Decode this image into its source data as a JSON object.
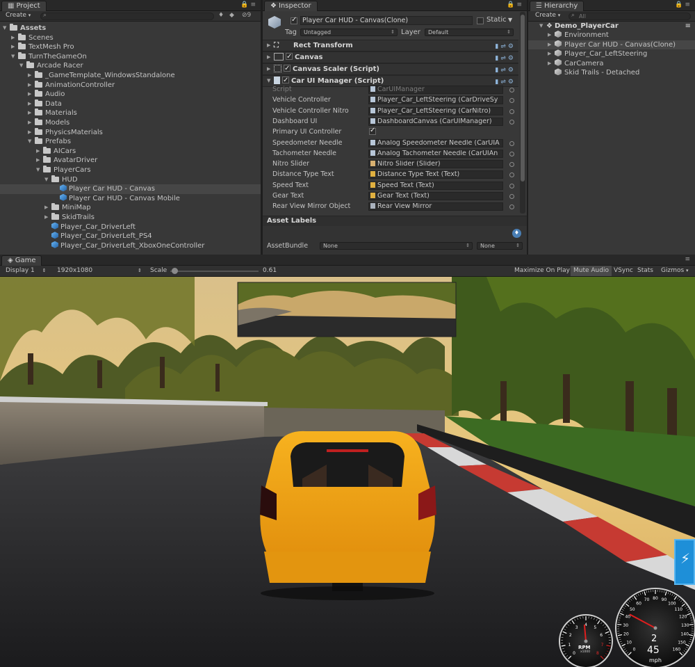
{
  "project": {
    "tab": "Project",
    "create": "Create",
    "filter_count": "9",
    "tree": [
      {
        "label": "Assets",
        "depth": 0,
        "arrow": "open",
        "bold": true
      },
      {
        "label": "Scenes",
        "depth": 1,
        "arrow": "closed"
      },
      {
        "label": "TextMesh Pro",
        "depth": 1,
        "arrow": "closed"
      },
      {
        "label": "TurnTheGameOn",
        "depth": 1,
        "arrow": "open"
      },
      {
        "label": "Arcade Racer",
        "depth": 2,
        "arrow": "open"
      },
      {
        "label": "_GameTemplate_WindowsStandalone",
        "depth": 3,
        "arrow": "closed"
      },
      {
        "label": "AnimationController",
        "depth": 3,
        "arrow": "closed"
      },
      {
        "label": "Audio",
        "depth": 3,
        "arrow": "closed"
      },
      {
        "label": "Data",
        "depth": 3,
        "arrow": "closed"
      },
      {
        "label": "Materials",
        "depth": 3,
        "arrow": "closed"
      },
      {
        "label": "Models",
        "depth": 3,
        "arrow": "closed"
      },
      {
        "label": "PhysicsMaterials",
        "depth": 3,
        "arrow": "closed"
      },
      {
        "label": "Prefabs",
        "depth": 3,
        "arrow": "open"
      },
      {
        "label": "AICars",
        "depth": 4,
        "arrow": "closed"
      },
      {
        "label": "AvatarDriver",
        "depth": 4,
        "arrow": "closed"
      },
      {
        "label": "PlayerCars",
        "depth": 4,
        "arrow": "open"
      },
      {
        "label": "HUD",
        "depth": 5,
        "arrow": "open"
      },
      {
        "label": "Player Car HUD - Canvas",
        "depth": 6,
        "prefab": true,
        "selected": true
      },
      {
        "label": "Player Car HUD - Canvas Mobile",
        "depth": 6,
        "prefab": true
      },
      {
        "label": "MiniMap",
        "depth": 5,
        "arrow": "closed"
      },
      {
        "label": "SkidTrails",
        "depth": 5,
        "arrow": "closed"
      },
      {
        "label": "Player_Car_DriverLeft",
        "depth": 5,
        "prefab": true
      },
      {
        "label": "Player_Car_DriverLeft_PS4",
        "depth": 5,
        "prefab": true
      },
      {
        "label": "Player_Car_DriverLeft_XboxOneController",
        "depth": 5,
        "prefab": true
      }
    ]
  },
  "inspector": {
    "tab": "Inspector",
    "object_name": "Player Car HUD - Canvas(Clone)",
    "static_label": "Static",
    "tag_label": "Tag",
    "tag_value": "Untagged",
    "layer_label": "Layer",
    "layer_value": "Default",
    "components": [
      {
        "label": "Rect Transform",
        "checkbox": false
      },
      {
        "label": "Canvas",
        "checkbox": true
      },
      {
        "label": "Canvas Scaler (Script)",
        "checkbox": true
      },
      {
        "label": "Car UI Manager (Script)",
        "checkbox": true
      }
    ],
    "props": [
      {
        "label": "Script",
        "value": "CarUIManager",
        "icon": "script-icon",
        "disabled": true
      },
      {
        "label": "Vehicle Controller",
        "value": "Player_Car_LeftSteering (CarDriveSy",
        "icon": "script-icon"
      },
      {
        "label": "Vehicle Controller Nitro",
        "value": "Player_Car_LeftSteering (CarNitro)",
        "icon": "script-icon"
      },
      {
        "label": "Dashboard UI",
        "value": "DashboardCanvas (CarUIManager)",
        "icon": "script-icon"
      },
      {
        "label": "Primary UI Controller",
        "value": "",
        "checkbox": true
      },
      {
        "label": "Speedometer Needle",
        "value": "Analog Speedometer Needle (CarUIA",
        "icon": "script-icon"
      },
      {
        "label": "Tachometer Needle",
        "value": "Analog Tachometer Needle (CarUIAn",
        "icon": "script-icon"
      },
      {
        "label": "Nitro Slider",
        "value": "Nitro Slider (Slider)",
        "icon": "slider-icon"
      },
      {
        "label": "Distance Type Text",
        "value": "Distance Type Text (Text)",
        "icon": "text-icon"
      },
      {
        "label": "Speed Text",
        "value": "Speed Text (Text)",
        "icon": "text-icon"
      },
      {
        "label": "Gear Text",
        "value": "Gear Text (Text)",
        "icon": "text-icon"
      },
      {
        "label": "Rear View Mirror Object",
        "value": "Rear View Mirror",
        "icon": "gameobject-icon"
      }
    ],
    "asset_labels": "Asset Labels",
    "asset_bundle_label": "AssetBundle",
    "asset_bundle_value": "None",
    "asset_bundle_variant": "None"
  },
  "hierarchy": {
    "tab": "Hierarchy",
    "create": "Create",
    "search_placeholder": "All",
    "scene": "Demo_PlayerCar",
    "items": [
      {
        "label": "Environment",
        "arrow": true
      },
      {
        "label": "Player Car HUD - Canvas(Clone)",
        "arrow": true,
        "selected": true
      },
      {
        "label": "Player_Car_LeftSteering",
        "arrow": true
      },
      {
        "label": "CarCamera",
        "arrow": true
      },
      {
        "label": "Skid Trails - Detached",
        "arrow": false
      }
    ]
  },
  "game": {
    "tab": "Game",
    "display": "Display 1",
    "resolution": "1920x1080",
    "scale_label": "Scale",
    "scale_value": "0.61",
    "scale_fraction": 0.05,
    "maximize": "Maximize On Play",
    "mute": "Mute Audio",
    "vsync": "VSync",
    "stats": "Stats",
    "gizmos": "Gizmos"
  },
  "hud": {
    "rpm_label": "RPM",
    "rpm_multiplier": "x1000",
    "rpm_ticks": [
      "0",
      "1",
      "2",
      "3",
      "4",
      "5",
      "6",
      "7",
      "8"
    ],
    "speed_ticks": [
      "0",
      "10",
      "20",
      "30",
      "40",
      "50",
      "60",
      "70",
      "80",
      "90",
      "100",
      "110",
      "120",
      "130",
      "140",
      "150",
      "160"
    ],
    "gear": "2",
    "speed": "45",
    "speed_unit": "mph",
    "nitro_fraction": 1.0
  },
  "colors": {
    "accent": "#1e8fd8",
    "car_body": "#f2a51a"
  }
}
